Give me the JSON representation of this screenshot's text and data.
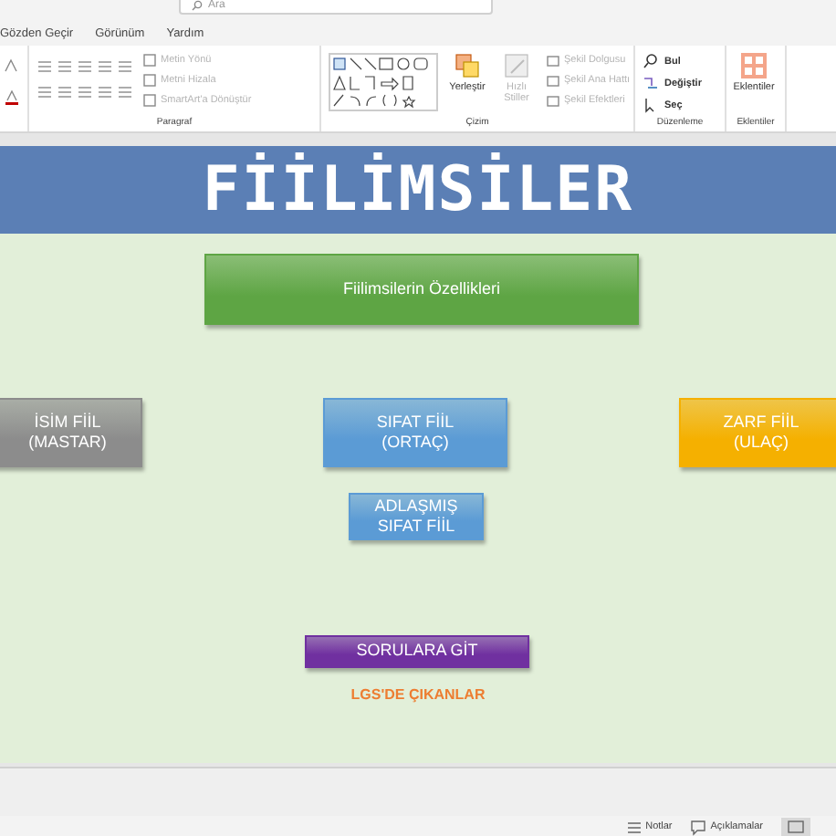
{
  "search": {
    "placeholder": "Ara"
  },
  "tabs": [
    {
      "label": "Gözden Geçir",
      "selected": false
    },
    {
      "label": "Görünüm",
      "selected": false
    },
    {
      "label": "Yardım",
      "selected": false
    }
  ],
  "ribbon": [
    {
      "kind": "font"
    },
    {
      "kind": "paragraph",
      "label": "Paragraf",
      "commands": [
        {
          "label": "Metin Yönü",
          "disabled": true
        },
        {
          "label": "Metni Hizala",
          "disabled": true
        },
        {
          "label": "SmartArt'a Dönüştür",
          "disabled": true
        }
      ]
    },
    {
      "kind": "drawing",
      "label": "Çizim",
      "commands": [
        {
          "label": "Yerleştir",
          "disabled": false
        },
        {
          "label": "Hızlı Stiller",
          "disabled": true
        },
        {
          "label": "Şekil Dolgusu",
          "disabled": true
        },
        {
          "label": "Şekil Ana Hattı",
          "disabled": true
        },
        {
          "label": "Şekil Efektleri",
          "disabled": true
        }
      ]
    },
    {
      "kind": "editing",
      "label": "Düzenleme",
      "commands": [
        {
          "label": "Bul",
          "disabled": false
        },
        {
          "label": "Değiştir",
          "disabled": false
        },
        {
          "label": "Seç",
          "disabled": false
        }
      ]
    },
    {
      "kind": "addins",
      "label": "Eklentiler",
      "commands": [
        {
          "label": "Eklentiler",
          "disabled": false
        }
      ]
    }
  ],
  "slide": {
    "title": "FİİLİMSİLER",
    "shapes": [
      {
        "kind": "box",
        "text": "Fiilimsilerin Özellikleri",
        "color": "#5ea544"
      },
      {
        "kind": "box",
        "text": "İSİM FİİL\n(MASTAR)",
        "color": "#8c8c8c"
      },
      {
        "kind": "box",
        "text": "SIFAT FİİL\n(ORTAÇ)",
        "color": "#5b9bd5"
      },
      {
        "kind": "box",
        "text": "ZARF FİİL\n(ULAÇ)",
        "color": "#f5b000"
      },
      {
        "kind": "box",
        "text": "ADLAŞMIŞ\nSIFAT FİİL",
        "color": "#5b9bd5"
      },
      {
        "kind": "box",
        "text": "SORULARA GİT",
        "color": "#7030a0"
      },
      {
        "kind": "link",
        "text": "LGS'DE ÇIKANLAR",
        "color": "#ed7d31"
      }
    ]
  },
  "status_bar": {
    "items": [
      "Notlar",
      "Açıklamalar"
    ]
  }
}
